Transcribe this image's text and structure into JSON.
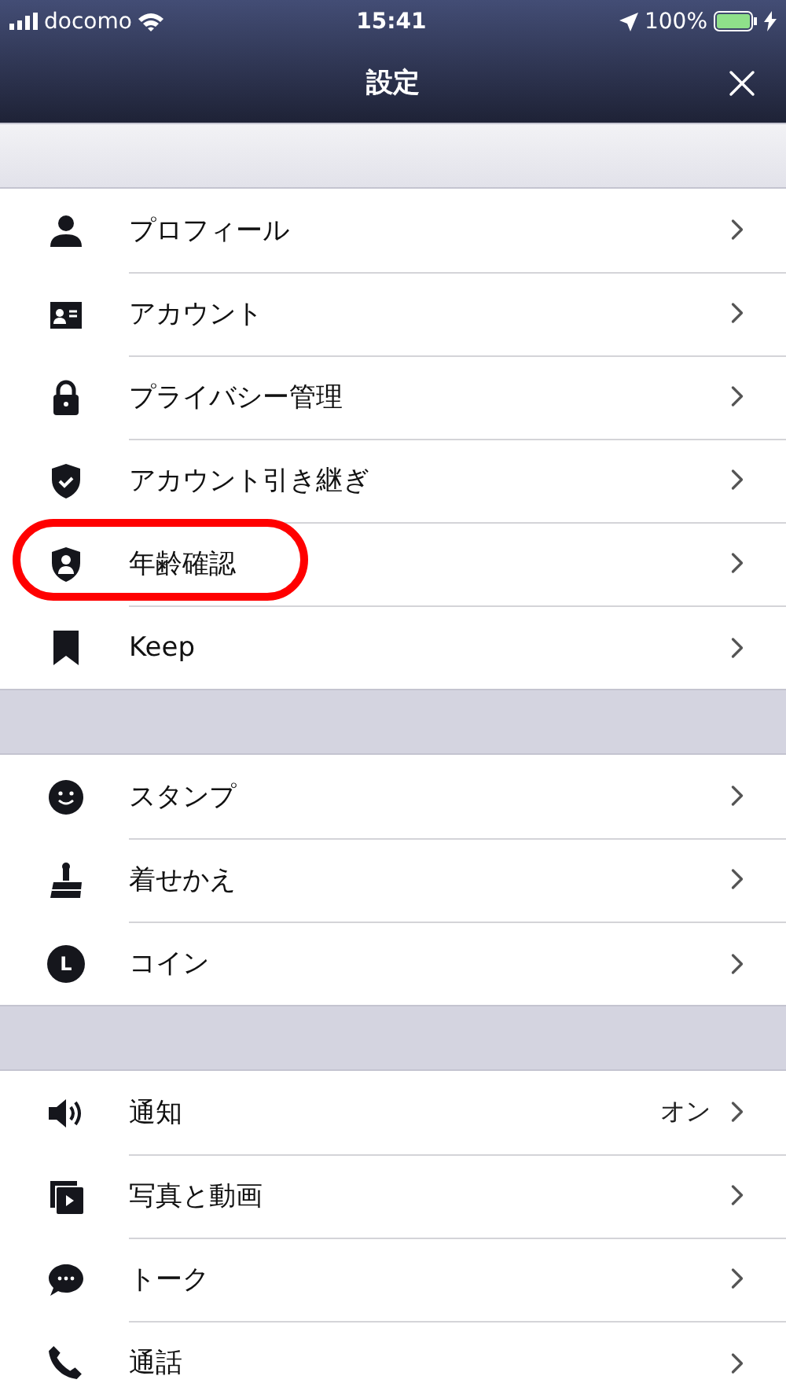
{
  "status_bar": {
    "carrier": "docomo",
    "time": "15:41",
    "battery": "100%",
    "charging": true
  },
  "nav": {
    "title": "設定"
  },
  "sections": [
    {
      "items": [
        {
          "kind": "person",
          "label": "プロフィール",
          "highlighted": false
        },
        {
          "kind": "id-card",
          "label": "アカウント",
          "highlighted": false
        },
        {
          "kind": "lock",
          "label": "プライバシー管理",
          "highlighted": false
        },
        {
          "kind": "shield-check",
          "label": "アカウント引き継ぎ",
          "highlighted": false
        },
        {
          "kind": "shield-person",
          "label": "年齢確認",
          "highlighted": true
        },
        {
          "kind": "bookmark",
          "label": "Keep",
          "highlighted": false
        }
      ]
    },
    {
      "items": [
        {
          "kind": "smiley",
          "label": "スタンプ",
          "highlighted": false
        },
        {
          "kind": "brush",
          "label": "着せかえ",
          "highlighted": false
        },
        {
          "kind": "coin",
          "badge": "L",
          "label": "コイン",
          "highlighted": false
        }
      ]
    },
    {
      "items": [
        {
          "kind": "speaker",
          "label": "通知",
          "value": "オン",
          "highlighted": false
        },
        {
          "kind": "media",
          "label": "写真と動画",
          "highlighted": false
        },
        {
          "kind": "chat",
          "label": "トーク",
          "highlighted": false
        },
        {
          "kind": "phone",
          "label": "通話",
          "highlighted": false
        }
      ]
    }
  ]
}
